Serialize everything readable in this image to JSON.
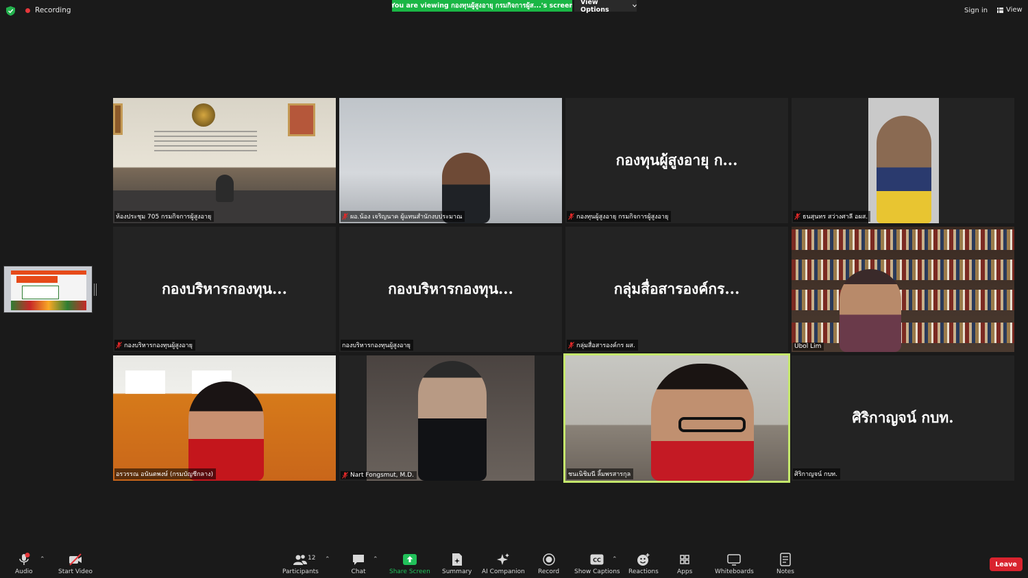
{
  "topbar": {
    "recording_label": "Recording",
    "viewing_banner": "You are viewing กองทุนผู้สูงอายุ กรมกิจการผู้ส...'s screen",
    "view_options_label": "View Options",
    "sign_in_label": "Sign in",
    "view_label": "View",
    "colors": {
      "banner": "#1ab645",
      "recording_dot": "#e5373b"
    }
  },
  "tiles": [
    {
      "kind": "video",
      "scene": "room",
      "name": "ห้องประชุม 705 กรมกิจการผู้สูงอายุ",
      "muted": false
    },
    {
      "kind": "video",
      "scene": "office",
      "name": "ผอ.น้อง  เจริญนาค ผู้แทนสำนักงบประมาณ",
      "muted": true
    },
    {
      "kind": "avatar",
      "display": "กองทุนผู้สูงอายุ ก...",
      "name": "กองทุนผู้สูงอายุ กรมกิจการผู้สูงอายุ",
      "muted": true
    },
    {
      "kind": "video",
      "scene": "portrait",
      "name": "ธนสุนทร สว่างศาลี อผส.",
      "muted": true
    },
    {
      "kind": "avatar",
      "display": "กองบริหารกองทุน...",
      "name": "กองบริหารกองทุนผู้สูงอายุ",
      "muted": true
    },
    {
      "kind": "avatar",
      "display": "กองบริหารกองทุน...",
      "name": "กองบริหารกองทุนผู้สูงอายุ",
      "muted": false
    },
    {
      "kind": "avatar",
      "display": "กลุ่มสื่อสารองค์กร...",
      "name": "กลุ่มสื่อสารองค์กร ผส.",
      "muted": true
    },
    {
      "kind": "video",
      "scene": "books",
      "name": "Ubol Lim",
      "muted": false
    },
    {
      "kind": "video",
      "scene": "orange",
      "name": "อรวรรณ อนันตพงษ์ (กรมบัญชีกลาง)",
      "muted": false
    },
    {
      "kind": "video",
      "scene": "bw",
      "name": "Nart Fongsmut, M.D.",
      "muted": true
    },
    {
      "kind": "video",
      "scene": "office2",
      "name": "ชนเนิชิมนี ลิ้มพรสารกุล",
      "muted": false,
      "active": true
    },
    {
      "kind": "avatar",
      "display": "ศิริกาญจน์ กบท.",
      "name": "ศิริกาญจน์ กบท.",
      "muted": false
    }
  ],
  "toolbar": {
    "audio": "Audio",
    "start_video": "Start Video",
    "participants": "Participants",
    "participants_count": "12",
    "chat": "Chat",
    "share_screen": "Share Screen",
    "summary": "Summary",
    "ai_companion": "AI Companion",
    "record": "Record",
    "show_captions": "Show Captions",
    "reactions": "Reactions",
    "apps": "Apps",
    "whiteboards": "Whiteboards",
    "notes": "Notes",
    "leave": "Leave",
    "colors": {
      "share_green": "#21c15a",
      "leave_red": "#d9232e"
    }
  },
  "icons": [
    "shield-icon",
    "grid-icon",
    "mic-off-icon",
    "video-off-icon",
    "participants-icon",
    "chat-icon",
    "share-screen-icon",
    "summary-icon",
    "ai-companion-icon",
    "record-icon",
    "captions-icon",
    "reactions-icon",
    "apps-icon",
    "whiteboard-icon",
    "notes-icon"
  ]
}
